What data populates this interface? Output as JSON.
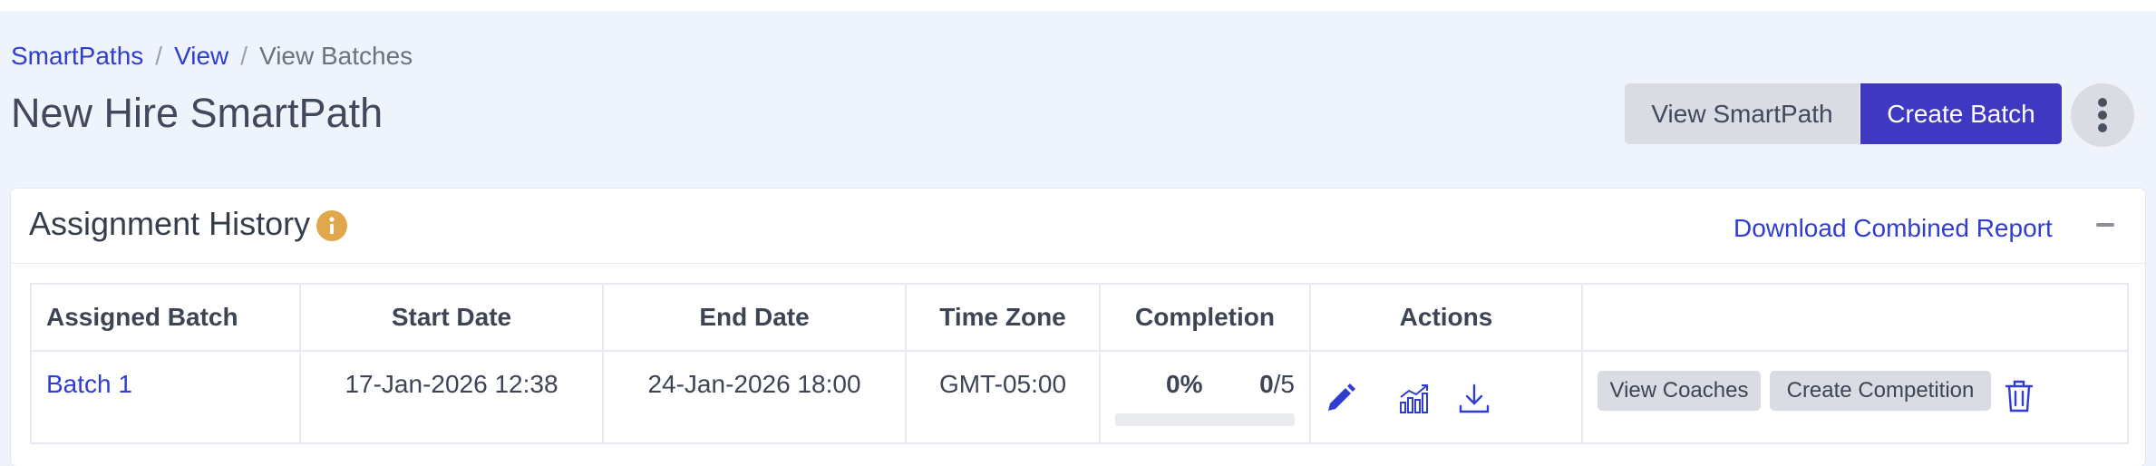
{
  "breadcrumb": {
    "items": [
      "SmartPaths",
      "View"
    ],
    "separator": "/",
    "current": "View Batches"
  },
  "page": {
    "title": "New Hire SmartPath"
  },
  "header_actions": {
    "view_label": "View SmartPath",
    "create_label": "Create Batch",
    "more_icon": "kebab-vertical-icon"
  },
  "card": {
    "title": "Assignment History",
    "info_icon": "info-icon",
    "download_label": "Download Combined Report",
    "collapse_icon": "minus-icon"
  },
  "table": {
    "columns": [
      "Assigned Batch",
      "Start Date",
      "End Date",
      "Time Zone",
      "Completion",
      "Actions",
      ""
    ],
    "rows": [
      {
        "batch": "Batch 1",
        "start": "17-Jan-2026 12:38",
        "end": "24-Jan-2026 18:00",
        "tz": "GMT-05:00",
        "completion_pct": "0%",
        "completed": "0",
        "total": "/5",
        "progress_fraction": 0,
        "actions": [
          "pencil-icon",
          "chart-icon",
          "download-icon"
        ],
        "view_coaches": "View Coaches",
        "create_competition": "Create Competition",
        "delete_icon": "trash-icon"
      }
    ]
  },
  "colors": {
    "accent": "#3f38c3",
    "link": "#2f3dd3",
    "page_bg": "#eef3fc",
    "info_badge": "#e0a84a",
    "chip_bg": "#d9dce2"
  }
}
